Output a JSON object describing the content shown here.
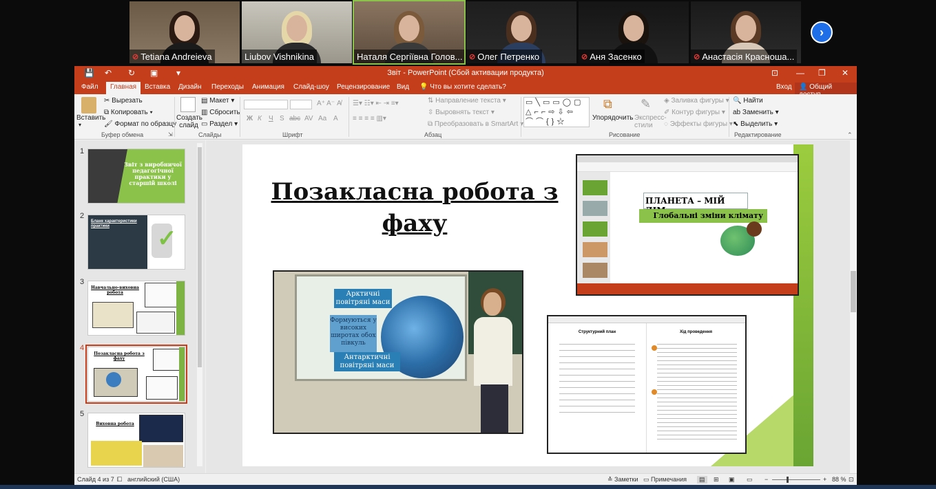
{
  "participants": [
    {
      "name": "Tetiana Andreieva",
      "muted": true
    },
    {
      "name": "Liubov Vishnikina",
      "muted": false
    },
    {
      "name": "Наталя Сергіївна Голов...",
      "muted": false
    },
    {
      "name": "Олег Петренко",
      "muted": true
    },
    {
      "name": "Аня Засенко",
      "muted": true
    },
    {
      "name": "Анастасія Красноша...",
      "muted": true
    }
  ],
  "next_button": "›",
  "window": {
    "title": "Звіт - PowerPoint (Сбой активации продукта)"
  },
  "tabs": [
    "Файл",
    "Главная",
    "Вставка",
    "Дизайн",
    "Переходы",
    "Анимация",
    "Слайд-шоу",
    "Рецензирование",
    "Вид"
  ],
  "tell_me": "Что вы хотите сделать?",
  "login": "Вход",
  "share": "Общий доступ",
  "ribbon": {
    "paste": "Вставить",
    "cut": "Вырезать",
    "copy": "Копировать",
    "format_painter": "Формат по образцу",
    "clipboard_group": "Буфер обмена",
    "new_slide": "Создать слайд",
    "layout": "Макет",
    "reset": "Сбросить",
    "section": "Раздел",
    "slides_group": "Слайды",
    "font_group": "Шрифт",
    "text_direction": "Направление текста",
    "align_text": "Выровнять текст",
    "smartart": "Преобразовать в SmartArt",
    "paragraph_group": "Абзац",
    "arrange": "Упорядочить",
    "quick_styles": "Экспресс-стили",
    "shape_fill": "Заливка фигуры",
    "shape_outline": "Контур фигуры",
    "shape_effects": "Эффекты фигуры",
    "drawing_group": "Рисование",
    "find": "Найти",
    "replace": "Заменить",
    "select": "Выделить",
    "editing_group": "Редактирование",
    "font_buttons": [
      "Ж",
      "К",
      "Ч",
      "S",
      "abc",
      "AV",
      "Aa",
      "A"
    ]
  },
  "thumbnails": [
    {
      "num": "1",
      "title": "Звіт з виробничої педагогічної практики у старшій школі"
    },
    {
      "num": "2",
      "title": "Бланк характеристики практики"
    },
    {
      "num": "3",
      "title": "Навчально-виховна робота"
    },
    {
      "num": "4",
      "title": "Позакласна робота з фаху",
      "selected": true
    },
    {
      "num": "5",
      "title": "Виховна робота"
    }
  ],
  "slide": {
    "title": "Позакласна робота з фаху",
    "photo": {
      "arctic": "Арктичні повітряні маси",
      "formed": "Формуються у високих широтах обох півкуль",
      "antarctic": "Антарктичні повітряні маси"
    },
    "screen": {
      "title": "ПЛАНЕТА – МІЙ ДІМ",
      "subtitle": "Глобальні зміни клімату"
    },
    "doc": {
      "left_heading": "Структурний план",
      "right_heading": "Хід проведення"
    }
  },
  "status": {
    "slide_info": "Слайд 4 из 7",
    "language": "английский (США)",
    "notes": "Заметки",
    "comments": "Примечания",
    "zoom": "88 %"
  },
  "colors": {
    "ppt_red": "#c43e1c",
    "slide_green": "#6aa533",
    "zoom_blue": "#1e6ee8"
  }
}
